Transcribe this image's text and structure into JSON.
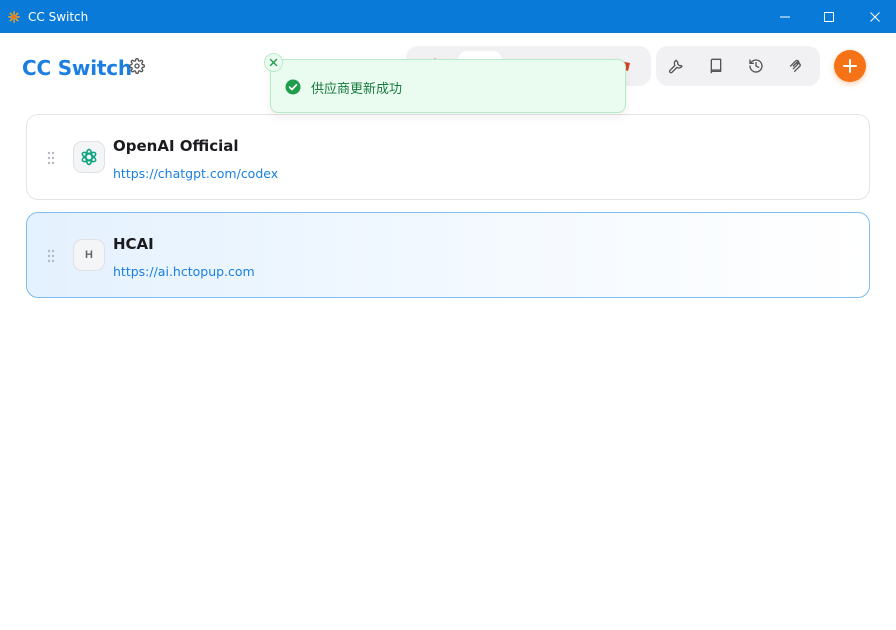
{
  "window": {
    "title": "CC Switch"
  },
  "header": {
    "brand": "CC Switch"
  },
  "toast": {
    "message": "供应商更新成功"
  },
  "providers": [
    {
      "name": "OpenAI Official",
      "url": "https://chatgpt.com/codex",
      "logo_icon": "openai-icon",
      "active": false
    },
    {
      "name": "HCAI",
      "url": "https://ai.hctopup.com",
      "logo_text": "H",
      "active": true
    }
  ],
  "colors": {
    "accent": "#1a7fe0",
    "titlebar": "#0a7ad8",
    "add_button": "#f57216",
    "success": "#1f9d4d"
  }
}
